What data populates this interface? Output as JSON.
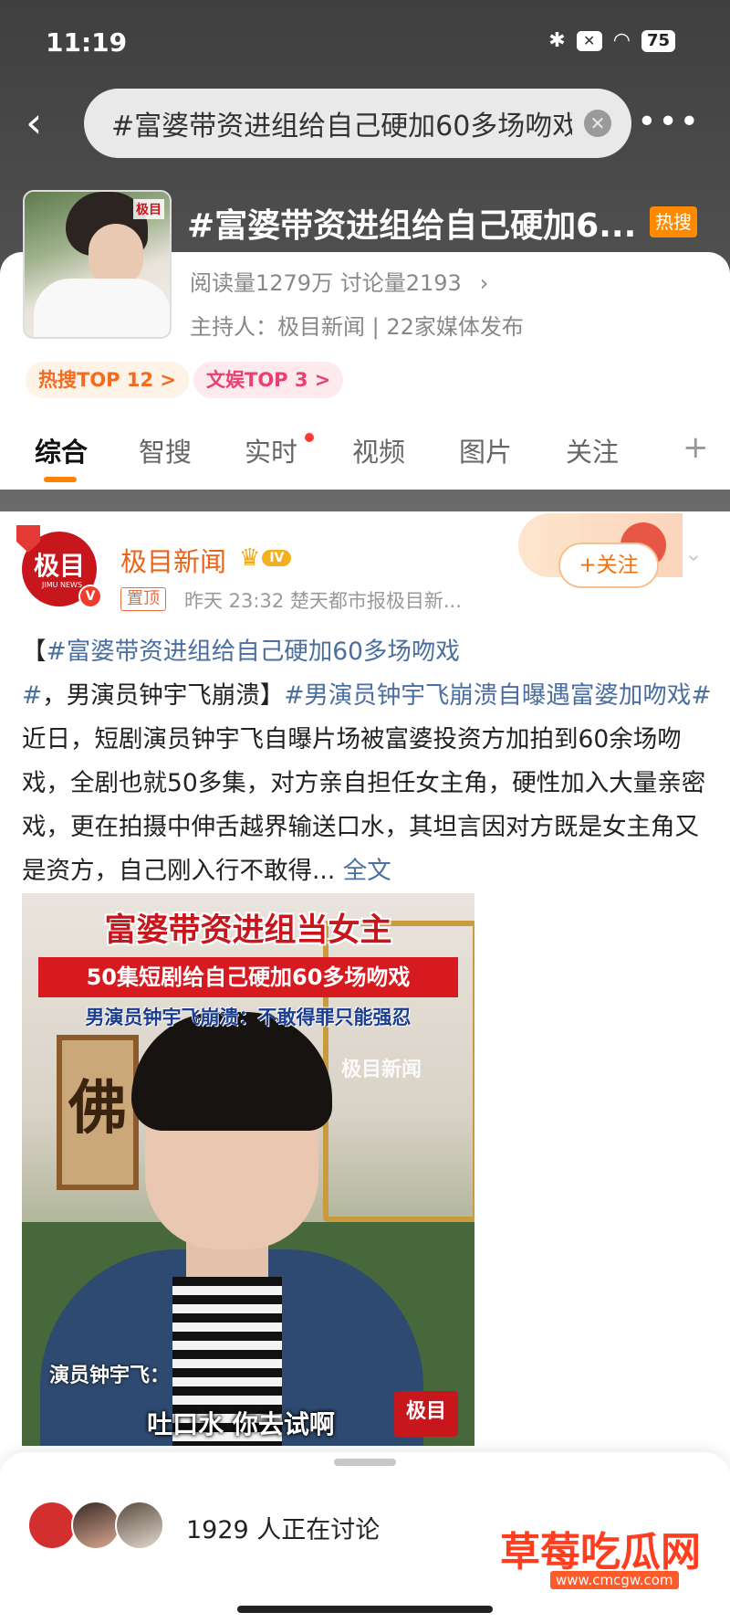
{
  "status": {
    "time": "11:19",
    "battery": "75"
  },
  "search": {
    "query": "#富婆带资进组给自己硬加60多场吻戏"
  },
  "topic": {
    "title": "#富婆带资进组给自己硬加6...",
    "hot_badge": "热搜",
    "stats": "阅读量1279万  讨论量2193",
    "host": "主持人：极目新闻 | 22家媒体发布",
    "thumb_watermark": "极目",
    "tags": [
      "热搜TOP 12 >",
      "文娱TOP 3 >"
    ]
  },
  "tabs": [
    "综合",
    "智搜",
    "实时",
    "视频",
    "图片",
    "关注"
  ],
  "post": {
    "avatar_text": "极目",
    "avatar_sub": "JIMU NEWS",
    "author": "极目新闻",
    "level": "IV",
    "pin": "置顶",
    "meta": "昨天 23:32  楚天都市报极目新...",
    "follow": "+关注",
    "body": {
      "bracket_open": "【",
      "hashtag1": "#富婆带资进组给自己硬加60多场吻戏#",
      "mid1": "，男演员钟宇飞崩溃】",
      "hashtag2": "#男演员钟宇飞崩溃自曝遇富婆加吻戏#",
      "rest": "近日，短剧演员钟宇飞自曝片场被富婆投资方加拍到60余场吻戏，全剧也就50多集，对方亲自担任女主角，硬性加入大量亲密戏，更在拍摄中伸舌越界输送口水，其坦言因对方既是女主角又是资方，自己刚入行不敢得... ",
      "full": "全文"
    },
    "video": {
      "caption1": "富婆带资进组当女主",
      "caption2": "50集短剧给自己硬加60多场吻戏",
      "caption3": "男演员钟宇飞崩溃：不敢得罪只能强忍",
      "watermark": "极目新闻",
      "calligraphy": "佛",
      "speaker": "演员钟宇飞：",
      "subtitle": "吐口水 你去试啊",
      "logo": "极目"
    }
  },
  "discussion": {
    "text": "1929 人正在讨论"
  },
  "brand": {
    "name": "草莓吃瓜网",
    "url": "www.cmcgw.com"
  }
}
